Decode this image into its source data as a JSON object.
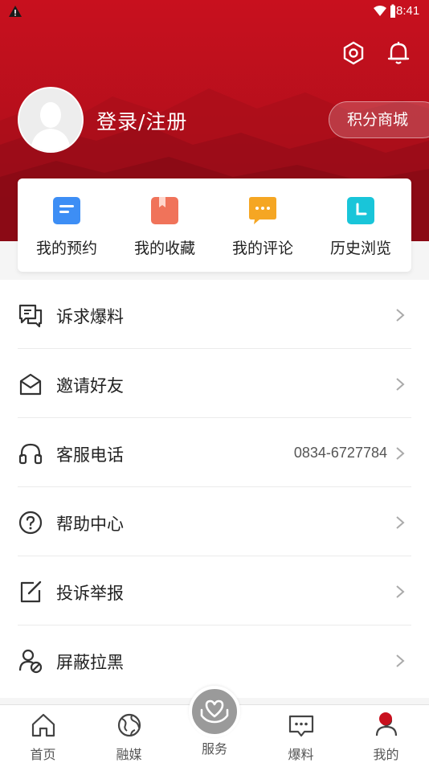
{
  "status_bar": {
    "time": "8:41"
  },
  "header": {
    "login_label": "登录/注册",
    "points_mall_label": "积分商城"
  },
  "quick_actions": [
    {
      "label": "我的预约",
      "icon": "appointment-icon",
      "color": "#3d8ef5"
    },
    {
      "label": "我的收藏",
      "icon": "favorites-icon",
      "color": "#f0735a"
    },
    {
      "label": "我的评论",
      "icon": "comment-icon",
      "color": "#f5a623"
    },
    {
      "label": "历史浏览",
      "icon": "history-icon",
      "color": "#19c5d9"
    }
  ],
  "menu": [
    {
      "label": "诉求爆料",
      "icon": "report-chat-icon",
      "value": ""
    },
    {
      "label": "邀请好友",
      "icon": "invite-mail-icon",
      "value": ""
    },
    {
      "label": "客服电话",
      "icon": "headset-icon",
      "value": "0834-6727784"
    },
    {
      "label": "帮助中心",
      "icon": "help-icon",
      "value": ""
    },
    {
      "label": "投诉举报",
      "icon": "edit-complaint-icon",
      "value": ""
    },
    {
      "label": "屏蔽拉黑",
      "icon": "block-user-icon",
      "value": ""
    }
  ],
  "tabs": [
    {
      "label": "首页",
      "icon": "home-icon"
    },
    {
      "label": "融媒",
      "icon": "globe-icon"
    },
    {
      "label": "服务",
      "icon": "service-heart-hands-icon"
    },
    {
      "label": "爆料",
      "icon": "chat-dots-icon"
    },
    {
      "label": "我的",
      "icon": "profile-icon"
    }
  ],
  "colors": {
    "brand_red": "#c8101e",
    "text": "#222222",
    "secondary_text": "#555555"
  }
}
